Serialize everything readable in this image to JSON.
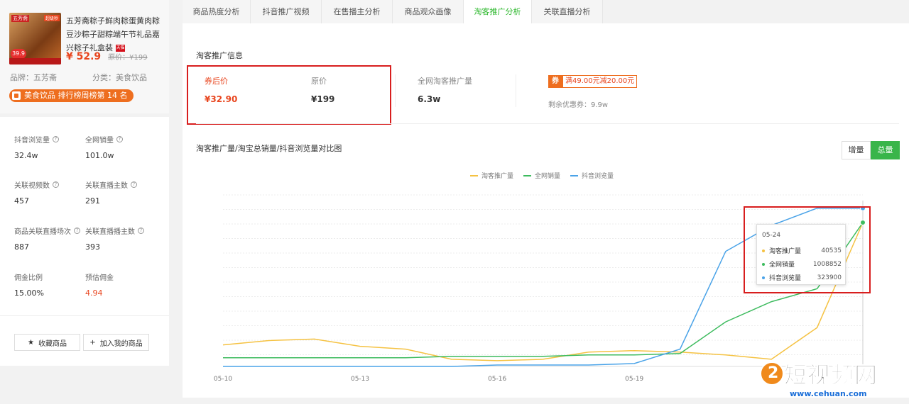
{
  "product": {
    "title": "五芳斋粽子鲜肉粽蛋黄肉粽豆沙粽子甜粽端午节礼品嘉兴粽子礼盒装",
    "image_badge": "39.9",
    "image_tl": "五芳斋",
    "image_tr": "超级秒",
    "tmall_badge": "天猫",
    "price": "¥ 52.9",
    "orig_price": "原价：¥199",
    "brand": "品牌：五芳斋",
    "category": "分类：美食饮品",
    "rank": "美食饮品 排行榜周榜第 14 名"
  },
  "stats": [
    {
      "label": "抖音浏览量",
      "value": "32.4w",
      "help": true
    },
    {
      "label": "全网销量",
      "value": "101.0w",
      "help": true
    },
    {
      "label": "关联视频数",
      "value": "457",
      "help": true
    },
    {
      "label": "关联直播主数",
      "value": "291",
      "help": true
    },
    {
      "label": "商品关联直播场次",
      "value": "887",
      "help": true
    },
    {
      "label": "关联直播播主数",
      "value": "393",
      "help": true
    },
    {
      "label": "佣金比例",
      "value": "15.00%",
      "help": false
    },
    {
      "label": "预估佣金",
      "value": "4.94",
      "help": false
    }
  ],
  "actions": {
    "favorite": "收藏商品",
    "add_mine": "加入我的商品"
  },
  "tabs": [
    "商品热度分析",
    "抖音推广视频",
    "在售播主分析",
    "商品观众画像",
    "淘客推广分析",
    "关联直播分析"
  ],
  "active_tab": 4,
  "promo": {
    "section_title": "淘客推广信息",
    "after_coupon_label": "券后价",
    "after_coupon_value": "¥32.90",
    "orig_label": "原价",
    "orig_value": "¥199",
    "promo_count_label": "全网淘客推广量",
    "promo_count_value": "6.3w",
    "coupon_tag": "券",
    "coupon_text": "满49.00元减20.00元",
    "remaining": "剩余优惠券：9.9w"
  },
  "chart_section": {
    "title": "淘客推广量/淘宝总销量/抖音浏览量对比图",
    "toggle_incr": "增量",
    "toggle_total": "总量"
  },
  "colors": {
    "accent": "#39b54a",
    "orange": "#e8451e",
    "series_taoke": "#f5c242",
    "series_sales": "#3dbb5e",
    "series_douyin": "#4aa3e8"
  },
  "tooltip": {
    "date": "05-24",
    "rows": [
      {
        "name": "淘客推广量",
        "value": "40535"
      },
      {
        "name": "全网销量",
        "value": "1008852"
      },
      {
        "name": "抖音浏览量",
        "value": "323900"
      }
    ]
  },
  "watermark": {
    "text": "短视频网",
    "url": "www.cehuan.com"
  },
  "chart_data": {
    "type": "line",
    "x": [
      "05-10",
      "05-11",
      "05-12",
      "05-13",
      "05-14",
      "05-15",
      "05-16",
      "05-17",
      "05-18",
      "05-19",
      "05-20",
      "05-21",
      "05-22",
      "05-23",
      "05-24"
    ],
    "xticks": [
      "05-10",
      "05-13",
      "05-16",
      "05-19",
      "05-22"
    ],
    "legend": "top",
    "series": [
      {
        "name": "淘客推广量",
        "values": [
          0.15,
          0.18,
          0.19,
          0.14,
          0.12,
          0.05,
          0.04,
          0.05,
          0.1,
          0.11,
          0.1,
          0.08,
          0.05,
          0.27,
          1.0
        ]
      },
      {
        "name": "全网销量",
        "values": [
          0.06,
          0.06,
          0.06,
          0.06,
          0.06,
          0.07,
          0.07,
          0.07,
          0.08,
          0.08,
          0.09,
          0.31,
          0.45,
          0.54,
          1.0
        ]
      },
      {
        "name": "抖音浏览量",
        "values": [
          0.0,
          0.0,
          0.0,
          0.0,
          0.0,
          0.0,
          0.01,
          0.01,
          0.01,
          0.02,
          0.12,
          0.8,
          0.98,
          1.1,
          1.1
        ]
      }
    ]
  }
}
